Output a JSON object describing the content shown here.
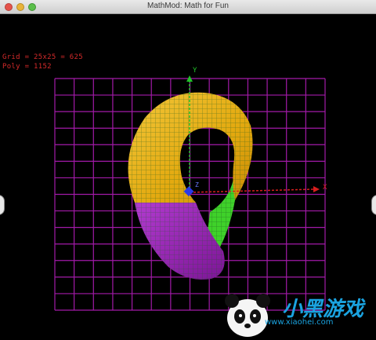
{
  "window": {
    "title": "MathMod: Math for Fun"
  },
  "overlay": {
    "grid": "Grid = 25x25 = 625",
    "poly": "Poly = 1152"
  },
  "axes": {
    "x_label": "X",
    "y_label": "Y",
    "z_label": "Z"
  },
  "watermark": {
    "brand": "小黑游戏",
    "url": "www.xiaohei.com"
  },
  "colors": {
    "grid": "#a21aa8",
    "x_axis": "#d81e1e",
    "y_axis": "#22c22a",
    "z_axis": "#2a3ae8",
    "surface_top": "#e8b21a",
    "surface_bottom": "#a42bc4",
    "surface_inner": "#3fd12a"
  }
}
